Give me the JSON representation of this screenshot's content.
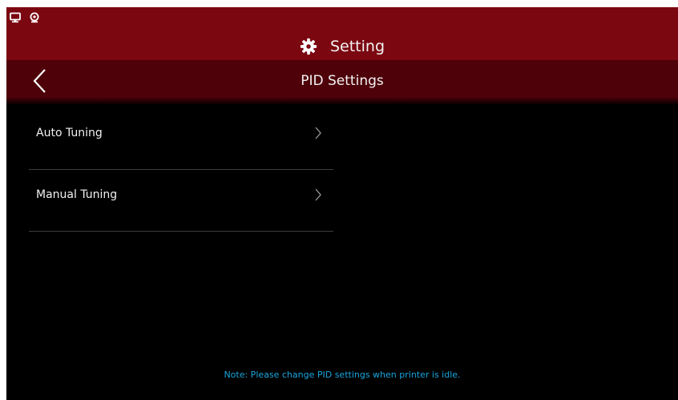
{
  "status_bar": {
    "icons": [
      "monitor-icon",
      "webcam-icon"
    ]
  },
  "header": {
    "title": "Setting",
    "icon": "gear-icon",
    "color": "#7b0711"
  },
  "subheader": {
    "title": "PID Settings",
    "back_icon": "chevron-left-icon",
    "color": "#4e0109"
  },
  "menu": {
    "items": [
      {
        "label": "Auto Tuning",
        "icon": "chevron-right-icon"
      },
      {
        "label": "Manual Tuning",
        "icon": "chevron-right-icon"
      }
    ]
  },
  "footer": {
    "note": "Note: Please change PID settings when printer is idle.",
    "note_color": "#1aa6de"
  }
}
